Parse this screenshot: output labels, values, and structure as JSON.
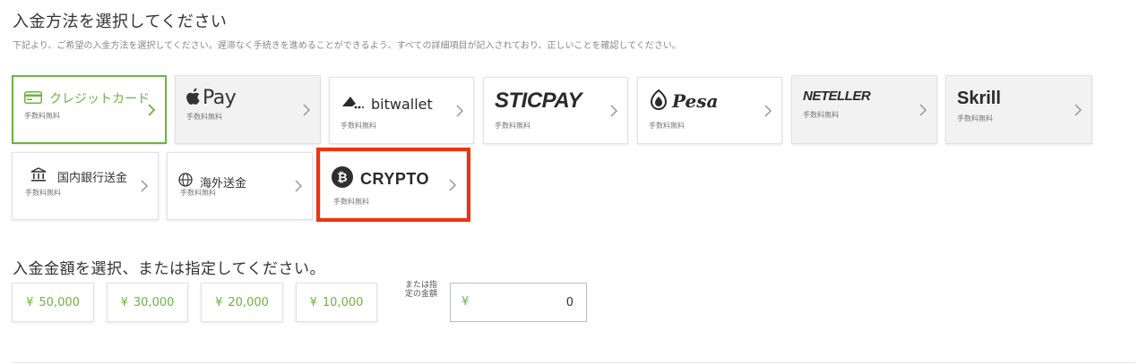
{
  "method_section": {
    "title": "入金方法を選択してください",
    "subtitle": "下記より、ご希望の入金方法を選択してください。遅滞なく手続きを進めることができるよう、すべての詳細項目が記入されており、正しいことを確認してください。"
  },
  "methods": [
    {
      "id": "credit",
      "label": "クレジットカード",
      "fee": "手数料無料",
      "icon": "credit-card-icon",
      "selected": true
    },
    {
      "id": "applepay",
      "label": "Pay",
      "fee": "手数料無料",
      "icon": "apple-icon"
    },
    {
      "id": "bitwallet",
      "label": "bitwallet",
      "fee": "手数料無料",
      "icon": "bitwallet-icon"
    },
    {
      "id": "sticpay",
      "label": "STICPAY",
      "fee": "手数料無料"
    },
    {
      "id": "pesa",
      "label": "Pesa",
      "fee": "手数料無料",
      "icon": "pesa-icon"
    },
    {
      "id": "neteller",
      "label": "NETELLER",
      "fee": "手数料無料"
    },
    {
      "id": "skrill",
      "label": "Skrill",
      "fee": "手数料無料"
    },
    {
      "id": "bank_domestic",
      "label": "国内銀行送金",
      "fee": "手数料無料",
      "icon": "bank-icon"
    },
    {
      "id": "bank_overseas",
      "label": "海外送金",
      "fee": "手数料無料",
      "icon": "globe-icon"
    },
    {
      "id": "crypto",
      "label": "CRYPTO",
      "fee": "手数料無料",
      "icon": "bitcoin-icon"
    }
  ],
  "amount_section": {
    "title": "入金金額を選択、または指定してください。",
    "currency_symbol": "¥",
    "presets": [
      "50,000",
      "30,000",
      "20,000",
      "10,000"
    ],
    "or_label": "または指定の金額",
    "custom_value": "0"
  },
  "colors": {
    "accent_green": "#6cb33f",
    "highlight_red": "#ee3311",
    "card_grey": "#f2f2f2"
  }
}
